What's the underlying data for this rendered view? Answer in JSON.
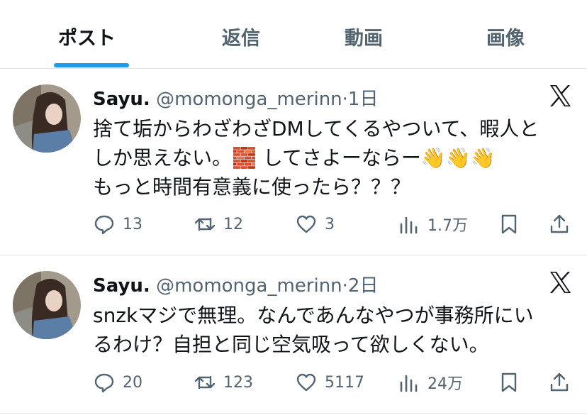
{
  "tabs": [
    {
      "label": "ポスト",
      "active": true
    },
    {
      "label": "返信",
      "active": false
    },
    {
      "label": "動画",
      "active": false
    },
    {
      "label": "画像",
      "active": false
    }
  ],
  "posts": [
    {
      "name": "Sayu.",
      "handle": "@momonga_merinn",
      "sep": "·",
      "time": "1日",
      "lines": [
        "捨て垢からわざわざDMしてくるやついて、暇人と",
        "しか思えない。🧱 してさよーならー👋👋👋",
        "もっと時間有意義に使ったら？？？"
      ],
      "stats": {
        "replies": "13",
        "reposts": "12",
        "likes": "3",
        "views": "1.7万"
      }
    },
    {
      "name": "Sayu.",
      "handle": "@momonga_merinn",
      "sep": "·",
      "time": "2日",
      "lines": [
        "snzkマジで無理。なんであんなやつが事務所にい",
        "るわけ？自担と同じ空気吸って欲しくない。"
      ],
      "stats": {
        "replies": "20",
        "reposts": "123",
        "likes": "5117",
        "views": "24万"
      }
    }
  ],
  "icons": {
    "reply": "reply-icon",
    "repost": "repost-icon",
    "like": "heart-icon",
    "views": "views-icon",
    "bookmark": "bookmark-icon",
    "share": "share-icon",
    "brand": "x-logo-icon"
  },
  "colors": {
    "accent": "#1d9bf0",
    "text": "#0f1419",
    "secondary": "#536471",
    "divider": "#e1e4e8"
  }
}
